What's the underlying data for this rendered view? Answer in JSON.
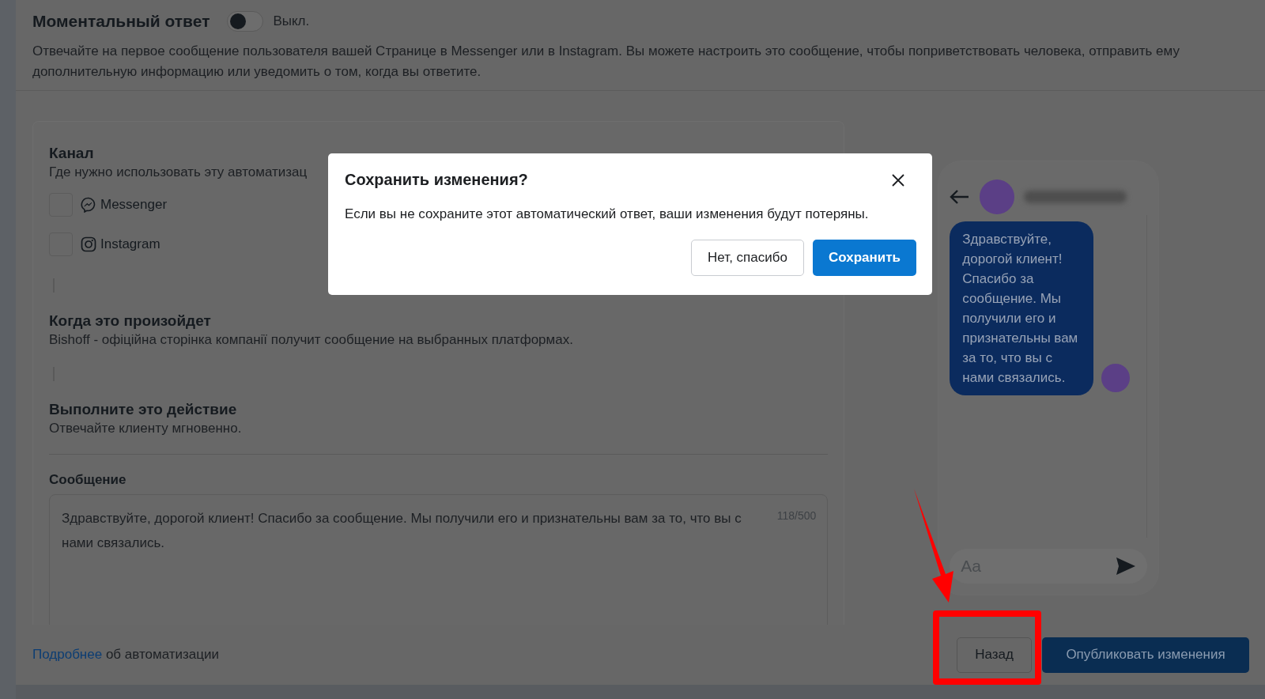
{
  "header": {
    "title": "Моментальный ответ",
    "toggle": {
      "on": false,
      "label": "Выкл."
    },
    "description": "Отвечайте на первое сообщение пользователя вашей Странице в Messenger или в Instagram. Вы можете настроить это сообщение, чтобы поприветствовать человека, отправить ему дополнительную информацию или уведомить о том, когда вы ответите."
  },
  "channel": {
    "title": "Канал",
    "subtitle": "Где нужно использовать эту автоматизац",
    "options": [
      {
        "kind": "messenger",
        "label": "Messenger",
        "checked": false
      },
      {
        "kind": "instagram",
        "label": "Instagram",
        "checked": false
      }
    ]
  },
  "trigger": {
    "title": "Когда это произойдет",
    "subtitle": "Bishoff - офіційна сторінка компанії получит сообщение на выбранных платформах."
  },
  "action": {
    "title": "Выполните это действие",
    "subtitle": "Отвечайте клиенту мгновенно."
  },
  "message": {
    "label": "Сообщение",
    "value": "Здравствуйте, дорогой клиент! Спасибо за сообщение. Мы получили его и признательны вам за то, что вы с нами связались.",
    "counter": "118/500"
  },
  "preview": {
    "bubble": "Здравствуйте, дорогой клиент! Спасибо за сообщение. Мы получили его и признательны вам за то, что вы с нами связались.",
    "input_placeholder": "Aa"
  },
  "footer": {
    "link": "Подробнее",
    "link_rest": "об автоматизации",
    "buttons": [
      {
        "kind": "secondary",
        "label": "Назад"
      },
      {
        "kind": "primary",
        "label": "Опубликовать изменения"
      }
    ]
  },
  "dialog": {
    "title": "Сохранить изменения?",
    "body": "Если вы не сохраните этот автоматический ответ, ваши изменения будут потеряны.",
    "buttons": [
      {
        "kind": "secondary",
        "label": "Нет, спасибо"
      },
      {
        "kind": "primary",
        "label": "Сохранить"
      }
    ]
  }
}
